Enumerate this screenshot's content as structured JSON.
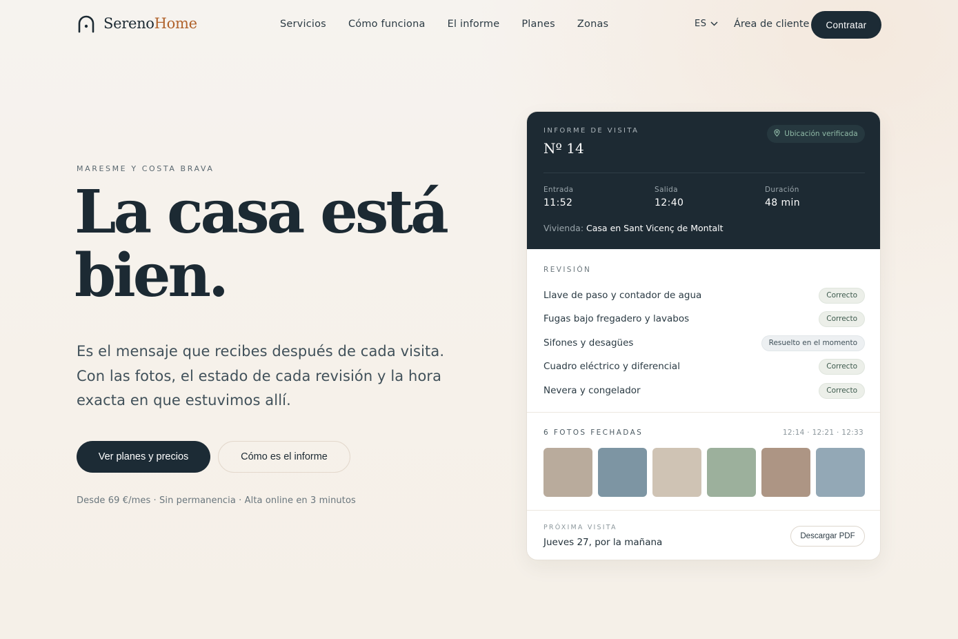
{
  "brand": {
    "name_part1": "Sereno",
    "name_part2": "Home"
  },
  "nav": {
    "links": [
      "Servicios",
      "Cómo funciona",
      "El informe",
      "Planes",
      "Zonas"
    ],
    "language": "ES",
    "client_area": "Área de cliente",
    "cta": "Contratar"
  },
  "hero": {
    "eyebrow": "MARESME Y COSTA BRAVA",
    "headline_line1": "La casa está",
    "headline_line2": "bien.",
    "subtitle": "Es el mensaje que recibes después de cada visita. Con las fotos, el estado de cada revisión y la hora exacta en que estuvimos allí.",
    "primary_button": "Ver planes y precios",
    "secondary_button": "Cómo es el informe",
    "fineprint": "Desde 69 €/mes · Sin permanencia · Alta online en 3 minutos"
  },
  "report": {
    "label": "INFORME DE VISITA",
    "number": "Nº 14",
    "badge": "Ubicación verificada",
    "stats": [
      {
        "label": "Entrada",
        "value": "11:52"
      },
      {
        "label": "Salida",
        "value": "12:40"
      },
      {
        "label": "Duración",
        "value": "48 min"
      }
    ],
    "home_label": "Vivienda:",
    "home_value": "Casa en Sant Vicenç de Montalt",
    "review_label": "REVISIÓN",
    "review_items": [
      {
        "item": "Llave de paso y contador de agua",
        "status": "Correcto"
      },
      {
        "item": "Fugas bajo fregadero y lavabos",
        "status": "Correcto"
      },
      {
        "item": "Sifones y desagües",
        "status": "Resuelto en el momento"
      },
      {
        "item": "Cuadro eléctrico y diferencial",
        "status": "Correcto"
      },
      {
        "item": "Nevera y congelador",
        "status": "Correcto"
      }
    ],
    "photos_label": "6 FOTOS FECHADAS",
    "photos_times": "12:14 · 12:21 · 12:33",
    "photo_colors": [
      "#b9ab9c",
      "#7d95a3",
      "#cfc3b4",
      "#9cb09c",
      "#ad9584",
      "#93a8b6"
    ],
    "next_label": "PRÓXIMA VISITA",
    "next_value": "Jueves 27, por la mañana",
    "pdf_button": "Descargar PDF"
  }
}
